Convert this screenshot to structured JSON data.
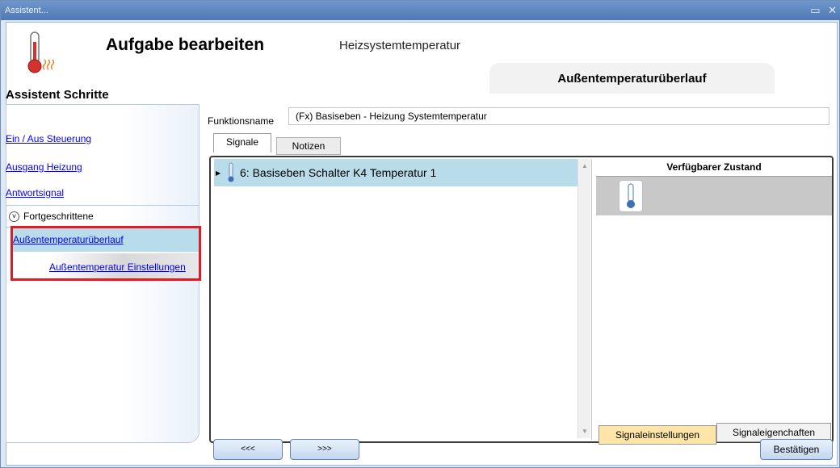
{
  "window": {
    "title": "Assistent...",
    "controls": "▭ ✕"
  },
  "header": {
    "title": "Aufgabe bearbeiten",
    "subtitle": "Heizsystemtemperatur",
    "current_step": "Außentemperaturüberlauf",
    "icon": "thermometer-heat-icon"
  },
  "sidebar": {
    "title": "Assistent Schritte",
    "items": [
      {
        "label": "Ein / Aus Steuerung"
      },
      {
        "label": "Ausgang Heizung"
      },
      {
        "label": "Antwortsignal"
      }
    ],
    "advanced": {
      "label": "Fortgeschrittene",
      "icon": "chevron-down-circle-icon"
    },
    "advanced_items": [
      {
        "label": "Außentemperaturüberlauf",
        "selected": true
      },
      {
        "label": "Außentemperatur Einstellungen"
      }
    ]
  },
  "function": {
    "label": "Funktionsname",
    "value": "(Fx) Basiseben - Heizung Systemtemperatur"
  },
  "tabs": [
    {
      "label": "Signale",
      "active": true
    },
    {
      "label": "Notizen"
    }
  ],
  "signals": [
    {
      "label": "6: Basiseben Schalter K4 Temperatur 1",
      "icon": "thermometer-icon"
    }
  ],
  "state_panel": {
    "title": "Verfügbarer Zustand",
    "icon": "thermometer-icon"
  },
  "bottom_tabs": [
    {
      "label": "Signaleinstellungen",
      "active": true
    },
    {
      "label": "Signaleigenchaften"
    }
  ],
  "buttons": {
    "prev": "<<<",
    "next": ">>>",
    "confirm": "Bestätigen"
  },
  "colors": {
    "titlebar": "#5b86c0",
    "selection": "#b9dcea",
    "highlight_box": "#e01b24",
    "active_tab": "#ffe6a8"
  }
}
